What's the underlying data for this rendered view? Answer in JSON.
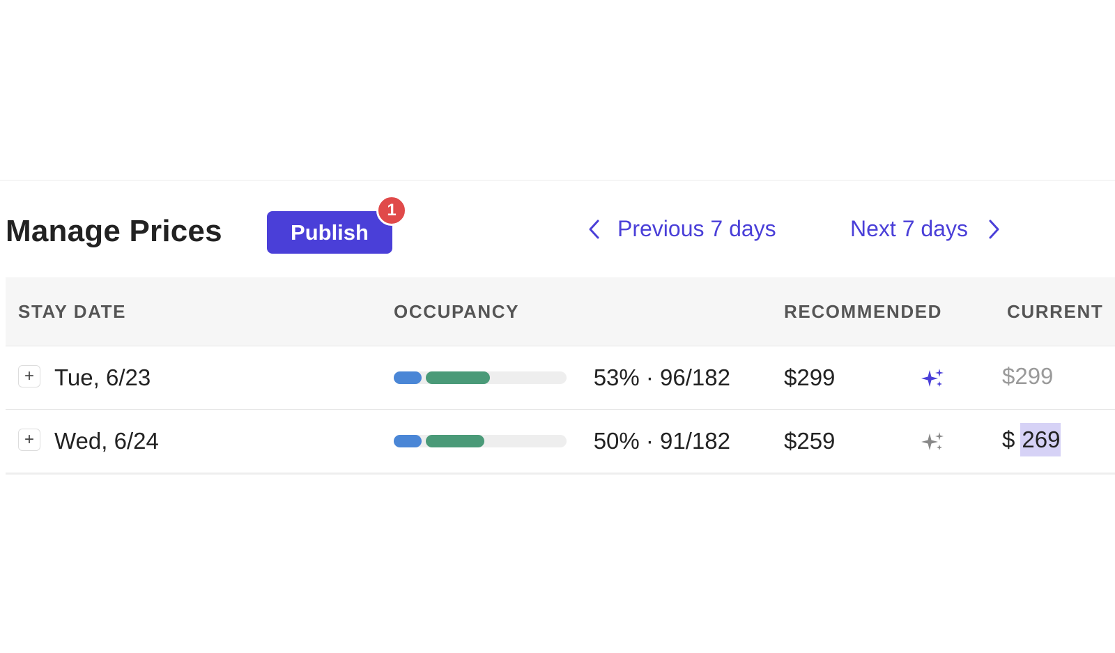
{
  "header": {
    "title": "Manage Prices",
    "publish_label": "Publish",
    "publish_badge": "1",
    "prev_label": "Previous 7 days",
    "next_label": "Next 7 days"
  },
  "table": {
    "columns": {
      "stay_date": "STAY DATE",
      "occupancy": "OCCUPANCY",
      "recommended": "RECOMMENDED",
      "current": "CURRENT"
    },
    "rows": [
      {
        "date": "Tue, 6/23",
        "occupancy_text": "53% · 96/182",
        "occupancy_booked_fraction": 0.16,
        "occupancy_pickup_fraction": 0.37,
        "recommended": "$299",
        "sparkle_icon": "sparkle-icon",
        "sparkle_state": "active",
        "current_display": "$299"
      },
      {
        "date": "Wed, 6/24",
        "occupancy_text": "50% · 91/182",
        "occupancy_booked_fraction": 0.16,
        "occupancy_pickup_fraction": 0.34,
        "recommended": "$259",
        "sparkle_icon": "sparkle-icon",
        "sparkle_state": "inactive",
        "current_currency": "$",
        "current_value": "269"
      }
    ]
  },
  "colors": {
    "accent": "#4a3fd8",
    "badge": "#e04a4a",
    "bar_blue": "#4a86d6",
    "bar_green": "#4a9a78",
    "sparkle_active": "#4a3fd8",
    "sparkle_inactive": "#888888",
    "selection": "#d6d2f6"
  }
}
